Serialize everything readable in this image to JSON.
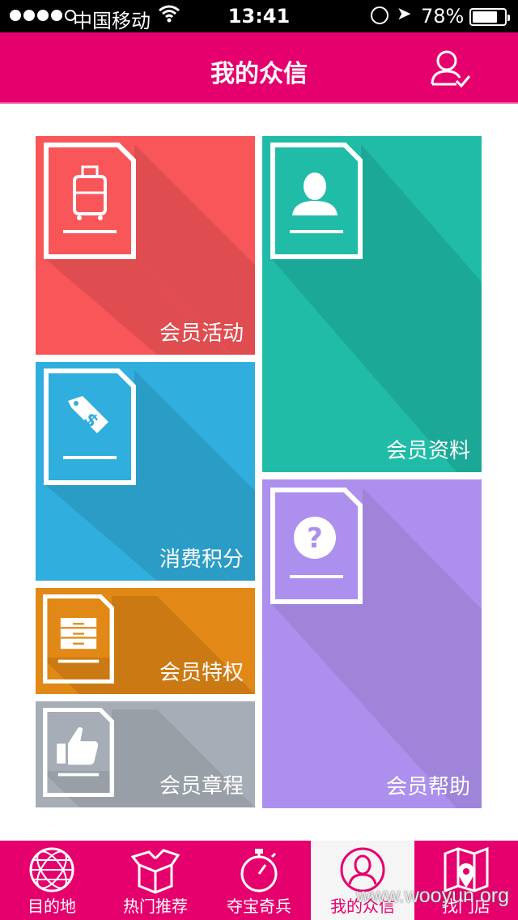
{
  "status_bar": {
    "carrier": "中国移动",
    "time": "13:41",
    "battery": "78%",
    "battery_level": 0.78,
    "icons": [
      "signal-dots-icon",
      "wifi-icon",
      "rotation-lock-icon",
      "location-arrow-icon",
      "battery-icon"
    ]
  },
  "nav": {
    "title": "我的众信",
    "account_icon": "user-check-icon"
  },
  "tiles": {
    "activity": {
      "label": "会员活动",
      "icon": "luggage-icon",
      "color": "#f9565a"
    },
    "profile": {
      "label": "会员资料",
      "icon": "person-icon",
      "color": "#20bca8"
    },
    "points": {
      "label": "消费积分",
      "icon": "price-tag-icon",
      "color": "#30aedd"
    },
    "privilege": {
      "label": "会员特权",
      "icon": "drawer-icon",
      "color": "#e28816"
    },
    "rules": {
      "label": "会员章程",
      "icon": "thumbs-up-icon",
      "color": "#a6adb6"
    },
    "help": {
      "label": "会员帮助",
      "icon": "question-icon",
      "color": "#ad90ed"
    }
  },
  "tab_bar": {
    "tabs": [
      {
        "label": "目的地",
        "icon": "globe-icon",
        "active": false
      },
      {
        "label": "热门推荐",
        "icon": "open-box-icon",
        "active": false
      },
      {
        "label": "夺宝奇兵",
        "icon": "stopwatch-icon",
        "active": false
      },
      {
        "label": "我的众信",
        "icon": "user-circle-icon",
        "active": true
      },
      {
        "label": "找门店",
        "icon": "map-pin-icon",
        "active": false
      }
    ]
  },
  "watermark": "www.wooyun.org",
  "colors": {
    "brand": "#e5006d"
  }
}
